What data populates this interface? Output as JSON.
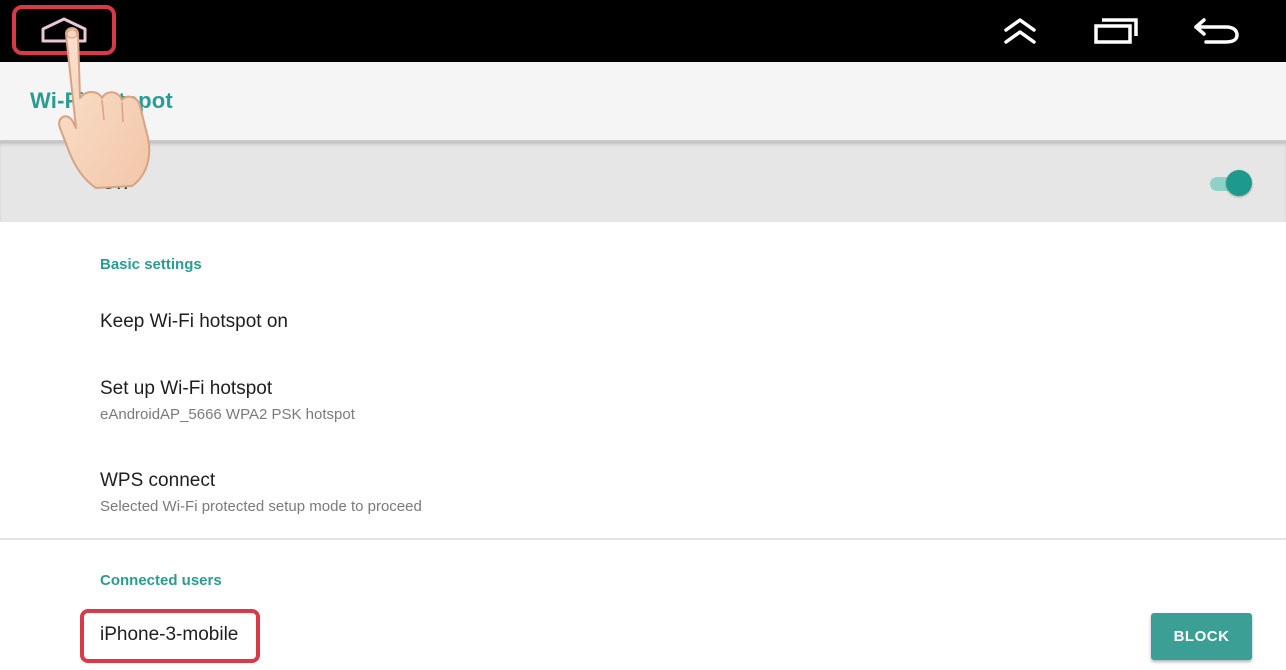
{
  "topbar": {
    "icons": {
      "home": "home-icon",
      "collapse": "double-chevron-up-icon",
      "recents": "recents-icon",
      "back": "back-arrow-icon"
    }
  },
  "header": {
    "title": "Wi-Fi hotspot"
  },
  "switch": {
    "label": "On",
    "state": "on"
  },
  "basic_settings": {
    "header": "Basic settings",
    "items": [
      {
        "primary": "Keep Wi-Fi hotspot on",
        "secondary": ""
      },
      {
        "primary": "Set up Wi-Fi hotspot",
        "secondary": "eAndroidAP_5666 WPA2 PSK hotspot"
      },
      {
        "primary": "WPS connect",
        "secondary": "Selected Wi-Fi protected setup mode to proceed"
      }
    ]
  },
  "connected_users": {
    "header": "Connected users",
    "users": [
      {
        "name": "iPhone-3-mobile",
        "action_label": "BLOCK"
      }
    ]
  },
  "colors": {
    "accent": "#2b9c92",
    "highlight": "#d83a4a",
    "topbar": "#000000",
    "button": "#3b9f95"
  }
}
